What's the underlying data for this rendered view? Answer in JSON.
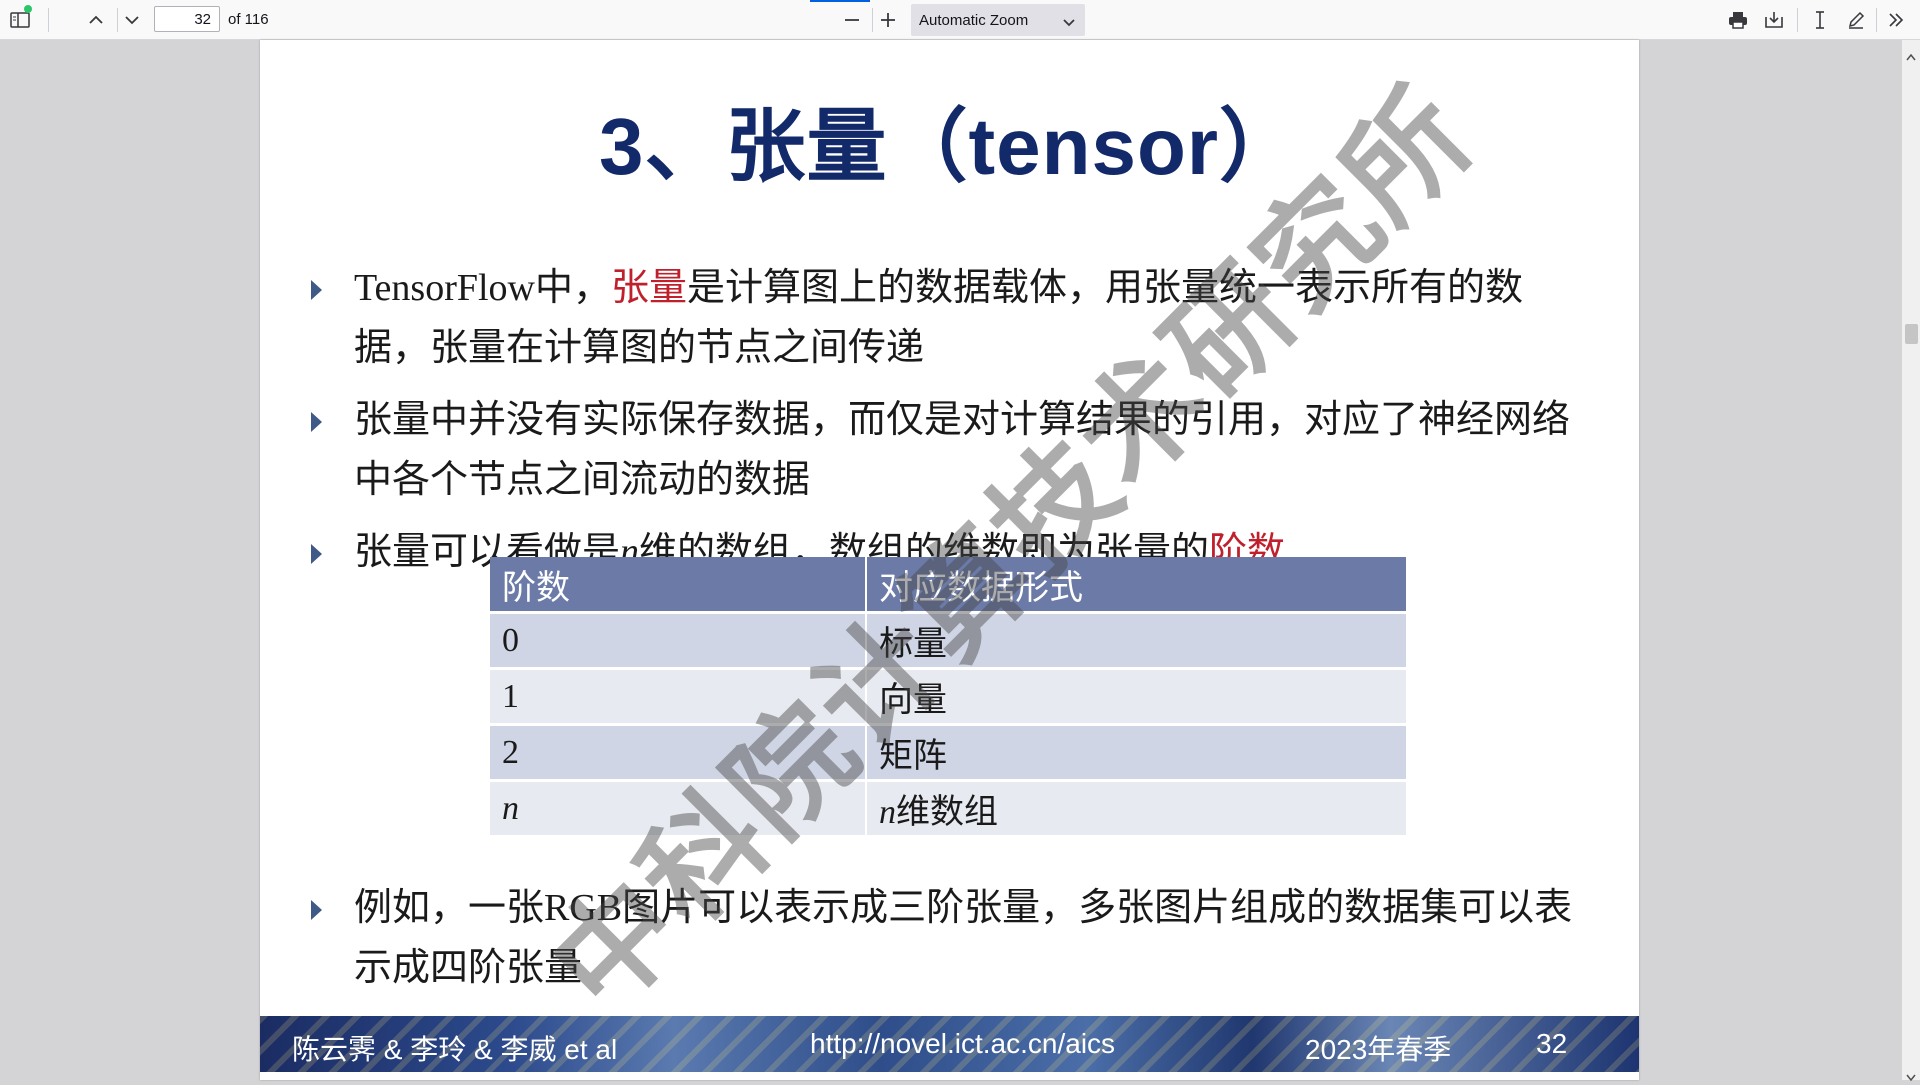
{
  "toolbar": {
    "page_number": "32",
    "page_count": "of 116",
    "zoom": "Automatic Zoom"
  },
  "slide": {
    "title": "3、张量（tensor）",
    "bullets": {
      "b1_pre": "TensorFlow中，",
      "b1_red": "张量",
      "b1_post": "是计算图上的数据载体，用张量统一表示所有的数据，张量在计算图的节点之间传递",
      "b2": "张量中并没有实际保存数据，而仅是对计算结果的引用，对应了神经网络中各个节点之间流动的数据",
      "b3_pre": "张量可以看做是",
      "b3_n": "n",
      "b3_mid": "维的数组，数组的维数即为张量的",
      "b3_red": "阶数",
      "b4": "例如，一张RGB图片可以表示成三阶张量，多张图片组成的数据集可以表示成四阶张量"
    },
    "table": {
      "headers": [
        "阶数",
        "对应数据形式"
      ],
      "rows": [
        [
          "0",
          "标量"
        ],
        [
          "1",
          "向量"
        ],
        [
          "2",
          "矩阵"
        ],
        [
          "n",
          "维数组"
        ]
      ],
      "row4_prefix": "n"
    },
    "watermark": "中科院计算技术研究所",
    "footer": {
      "authors": "陈云霁 & 李玲 & 李威 et al",
      "url": "http://novel.ict.ac.cn/aics",
      "term": "2023年春季",
      "page": "32"
    }
  },
  "colors": {
    "title": "#132a6a",
    "highlight": "#c0202c",
    "table_header": "#6b7aa7"
  }
}
